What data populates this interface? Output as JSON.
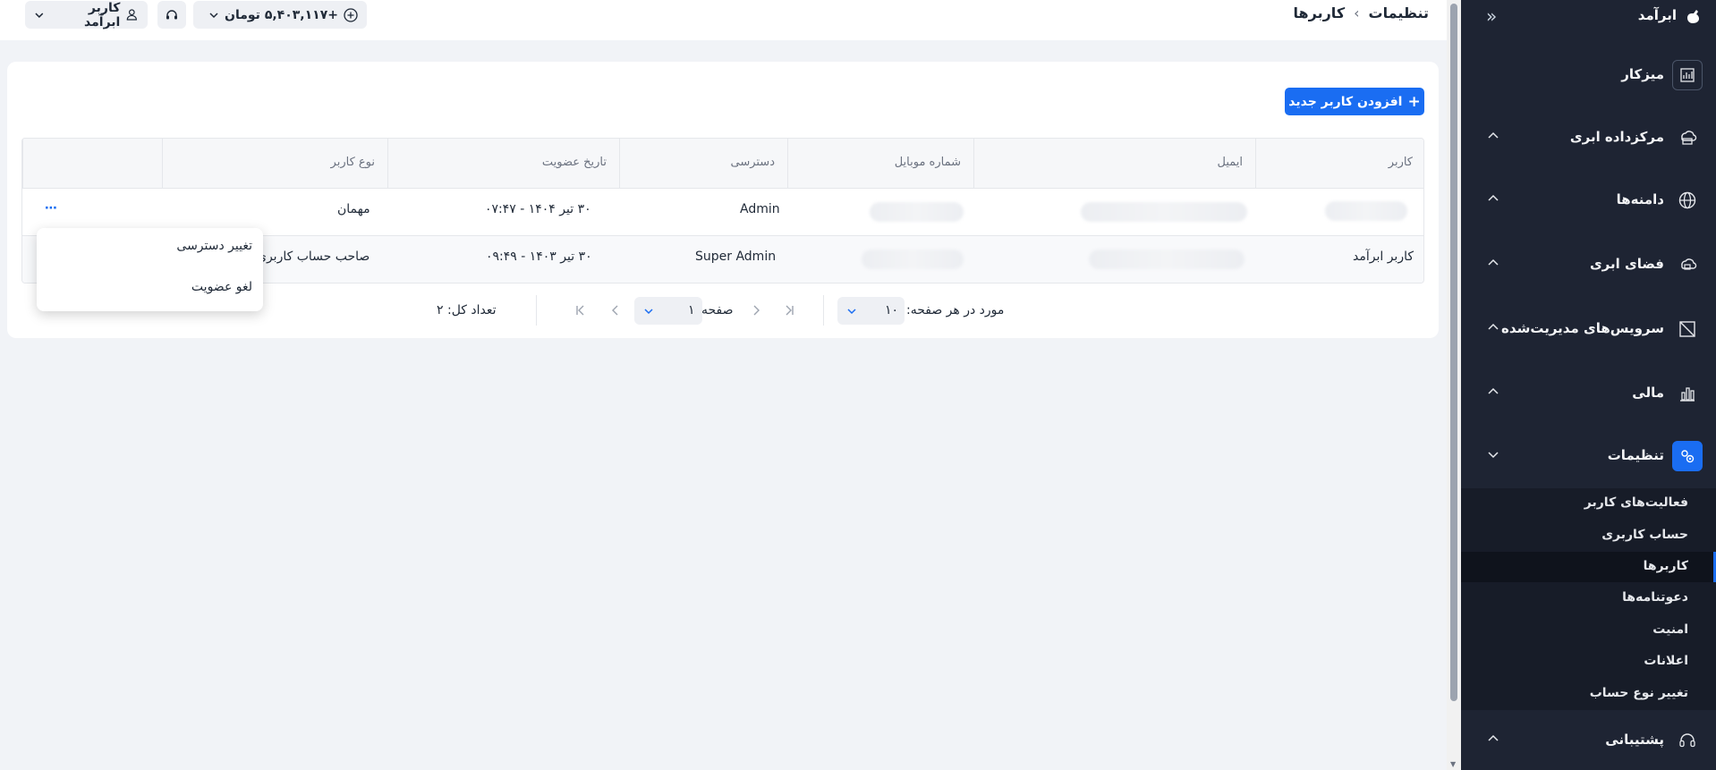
{
  "sidebar": {
    "brand": "ابرآمد",
    "items": [
      {
        "label": "میزکار",
        "icon": "dashboard-icon"
      },
      {
        "label": "مرکزداده ابری",
        "icon": "cloud-datacenter-icon"
      },
      {
        "label": "دامنه‌ها",
        "icon": "globe-icon"
      },
      {
        "label": "فضای ابری",
        "icon": "cloud-space-icon"
      },
      {
        "label": "سرویس‌های مدیریت‌شده",
        "icon": "managed-services-icon"
      },
      {
        "label": "مالی",
        "icon": "finance-chart-icon"
      },
      {
        "label": "تنظیمات",
        "icon": "settings-icon"
      },
      {
        "label": "پشتیبانی",
        "icon": "headset-icon"
      }
    ],
    "submenu": [
      "فعالیت‌های کاربر",
      "حساب کاربری",
      "کاربرها",
      "دعوتنامه‌ها",
      "امنیت",
      "اعلانات",
      "تغییر نوع حساب"
    ]
  },
  "header": {
    "breadcrumb_parent": "تنظیمات",
    "breadcrumb_current": "کاربرها",
    "balance": "+۵,۴۰۳,۱۱۷ تومان",
    "user": "کاربر ابرآمد"
  },
  "main": {
    "add_button": "افزودن کاربر جدید",
    "columns": [
      "کاربر",
      "ایمیل",
      "شماره موبایل",
      "دسترسی",
      "تاریخ عضویت",
      "نوع کاربر"
    ],
    "rows": [
      {
        "user": "",
        "access": "Admin",
        "date": "۳۰ تیر ۱۴۰۴ - ۰۷:۴۷",
        "type": "مهمان"
      },
      {
        "user": "کاربر ابرآمد",
        "access": "Super Admin",
        "date": "۳۰ تیر ۱۴۰۳ - ۰۹:۴۹",
        "type": "صاحب حساب کاربری"
      }
    ],
    "pager": {
      "per_page_label": "مورد در هر صفحه:",
      "per_page_value": "۱۰",
      "page_label": "صفحه",
      "page_value": "۱",
      "total": "تعداد کل: ۲"
    },
    "row_menu": {
      "change_access": "تغییر دسترسی",
      "revoke": "لغو عضویت"
    }
  },
  "colors": {
    "accent": "#1a6df2",
    "sidebar_bg": "#1e2433",
    "page_bg": "#f1f3f7"
  }
}
